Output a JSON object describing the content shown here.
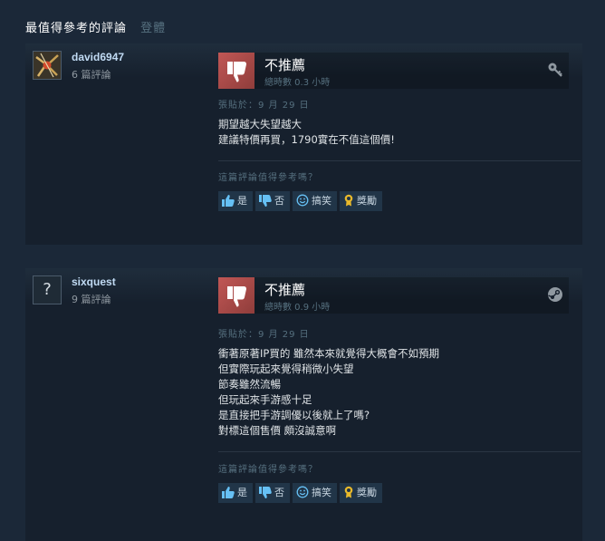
{
  "header": {
    "title": "最值得參考的評論",
    "tab": "登體"
  },
  "reviews": [
    {
      "username": "david6947",
      "review_count": "6 篇評論",
      "recommendation": "不推薦",
      "hours": "總時數 0.3 小時",
      "posted": "張貼於：9 月 29 日",
      "lines": [
        "期望越大失望越大",
        "建議特價再買，1790實在不值這個價!"
      ],
      "helpful_prompt": "這篇評論值得參考嗎？",
      "buttons": {
        "yes": "是",
        "no": "否",
        "funny": "搞笑",
        "award": "獎勵"
      },
      "platform_icon": "key-icon"
    },
    {
      "username": "sixquest",
      "review_count": "9 篇評論",
      "avatar_text": "?",
      "recommendation": "不推薦",
      "hours": "總時數 0.9 小時",
      "posted": "張貼於：9 月 29 日",
      "lines": [
        "衝著原著IP買的 雖然本來就覺得大概會不如預期",
        "但實際玩起來覺得稍微小失望",
        "節奏雖然流暢",
        "但玩起來手游感十足",
        "是直接把手游調優以後就上了嗎?",
        "對標這個售價 頗沒誠意啊"
      ],
      "helpful_prompt": "這篇評論值得參考嗎？",
      "buttons": {
        "yes": "是",
        "no": "否",
        "funny": "搞笑",
        "award": "獎勵"
      },
      "platform_icon": "steam-icon"
    }
  ],
  "colors": {
    "background": "#1b2838",
    "card": "#16202d",
    "thumb_down": "#b14d4b",
    "link": "#66c0f4"
  }
}
